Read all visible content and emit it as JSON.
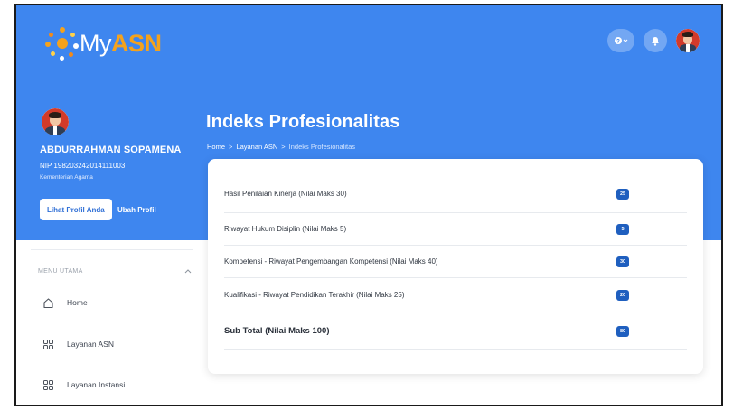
{
  "app": {
    "logo_my": "My",
    "logo_asn": "ASN"
  },
  "header": {
    "help_icon": "help-icon",
    "notification_icon": "bell-icon"
  },
  "profile": {
    "name": "ABDURRAHMAN SOPAMENA",
    "nip": "NIP 198203242014111003",
    "organization": "Kementerian Agama",
    "view_profile_label": "Lihat Profil Anda",
    "edit_profile_label": "Ubah Profil"
  },
  "page": {
    "title": "Indeks Profesionalitas",
    "breadcrumb": [
      "Home",
      "Layanan ASN",
      "Indeks Profesionalitas"
    ],
    "breadcrumb_separator": ">"
  },
  "sidebar": {
    "section_label": "MENU UTAMA",
    "items": [
      {
        "label": "Home",
        "icon": "home-icon"
      },
      {
        "label": "Layanan ASN",
        "icon": "grid-icon"
      },
      {
        "label": "Layanan Instansi",
        "icon": "grid-icon"
      }
    ]
  },
  "scores": {
    "rows": [
      {
        "label": "Hasil Penilaian Kinerja (Nilai Maks 30)",
        "value": "25"
      },
      {
        "label": "Riwayat Hukum Disiplin (Nilai Maks 5)",
        "value": "5"
      },
      {
        "label": "Kompetensi - Riwayat Pengembangan Kompetensi (Nilai Maks 40)",
        "value": "30"
      },
      {
        "label": "Kualifikasi - Riwayat Pendidikan Terakhir (Nilai Maks 25)",
        "value": "20"
      }
    ],
    "subtotal_label": "Sub Total (Nilai Maks 100)",
    "subtotal_value": "80"
  },
  "colors": {
    "primary_blue": "#3e86ef",
    "badge_blue": "#1f5fbf",
    "logo_orange": "#f4a21d"
  }
}
